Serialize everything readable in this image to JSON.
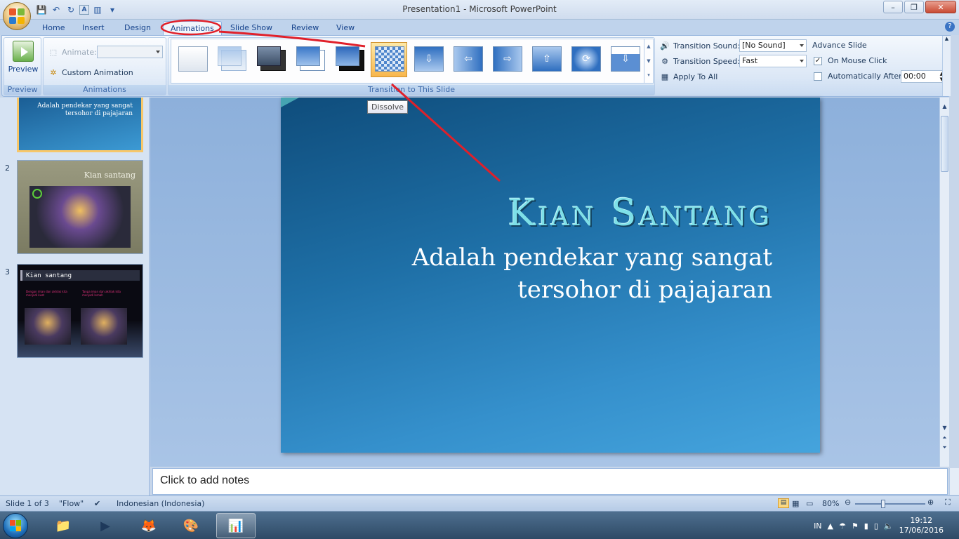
{
  "window": {
    "title": "Presentation1 - Microsoft PowerPoint",
    "controls": [
      "–",
      "❐",
      "✕"
    ]
  },
  "qat": {
    "save": "💾",
    "undo": "↶",
    "redo": "↻",
    "more": "▾"
  },
  "tabs": [
    {
      "label": "Home"
    },
    {
      "label": "Insert"
    },
    {
      "label": "Design"
    },
    {
      "label": "Animations"
    },
    {
      "label": "Slide Show"
    },
    {
      "label": "Review"
    },
    {
      "label": "View"
    }
  ],
  "ribbon": {
    "preview": {
      "button": "Preview",
      "group": "Preview"
    },
    "animations": {
      "animate_label": "Animate:",
      "animate_value": "",
      "custom_animation": "Custom Animation",
      "group": "Animations"
    },
    "transition": {
      "group": "Transition to This Slide",
      "sound_label": "Transition Sound:",
      "sound_value": "[No Sound]",
      "speed_label": "Transition Speed:",
      "speed_value": "Fast",
      "apply_all": "Apply To All"
    },
    "advance": {
      "title": "Advance Slide",
      "on_mouse_click": "On Mouse Click",
      "on_mouse_click_checked": true,
      "automatically_after": "Automatically After:",
      "automatically_after_checked": false,
      "time": "00:00"
    }
  },
  "tooltip": "Dissolve",
  "slides": [
    {
      "num": "",
      "text": "Adalah pendekar yang sangat tersohor di pajajaran"
    },
    {
      "num": "2",
      "title": "Kian santang"
    },
    {
      "num": "3",
      "title": "Kian santang",
      "left_text": "Dengan iman dan akhlak kita menjadi kuat",
      "right_text": "Tanpa iman dan akhlak kita menjadi lemah"
    }
  ],
  "current_slide": {
    "title": "Kian Santang",
    "subtitle": "Adalah pendekar yang sangat tersohor di pajajaran"
  },
  "notes_placeholder": "Click to add notes",
  "status": {
    "slide": "Slide 1 of 3",
    "theme": "\"Flow\"",
    "language": "Indonesian (Indonesia)",
    "zoom": "80%"
  },
  "taskbar": {
    "lang": "IN",
    "time": "19:12",
    "date": "17/06/2016"
  },
  "colors": {
    "accent": "#1e6fa6",
    "annotation": "#e0202a",
    "selected": "#f8b64c"
  }
}
